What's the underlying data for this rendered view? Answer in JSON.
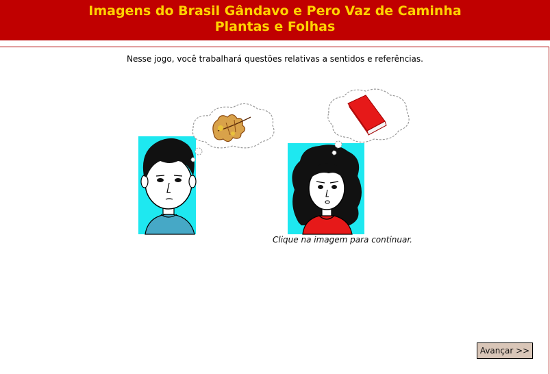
{
  "header": {
    "title_line1": "Imagens do Brasil Gândavo e Pero Vaz de Caminha",
    "title_line2": "Plantas e Folhas"
  },
  "main": {
    "intro_text": "Nesse jogo, você trabalhará questões relativas a sentidos e referências.",
    "caption": "Clique na imagem para continuar."
  },
  "footer": {
    "next_button_label": "Avançar >>"
  },
  "colors": {
    "header_bg": "#c00000",
    "header_text": "#ffd200",
    "cyan_bg": "#1ee8f0",
    "book_red": "#e61919",
    "button_bg": "#d9c6b8"
  }
}
